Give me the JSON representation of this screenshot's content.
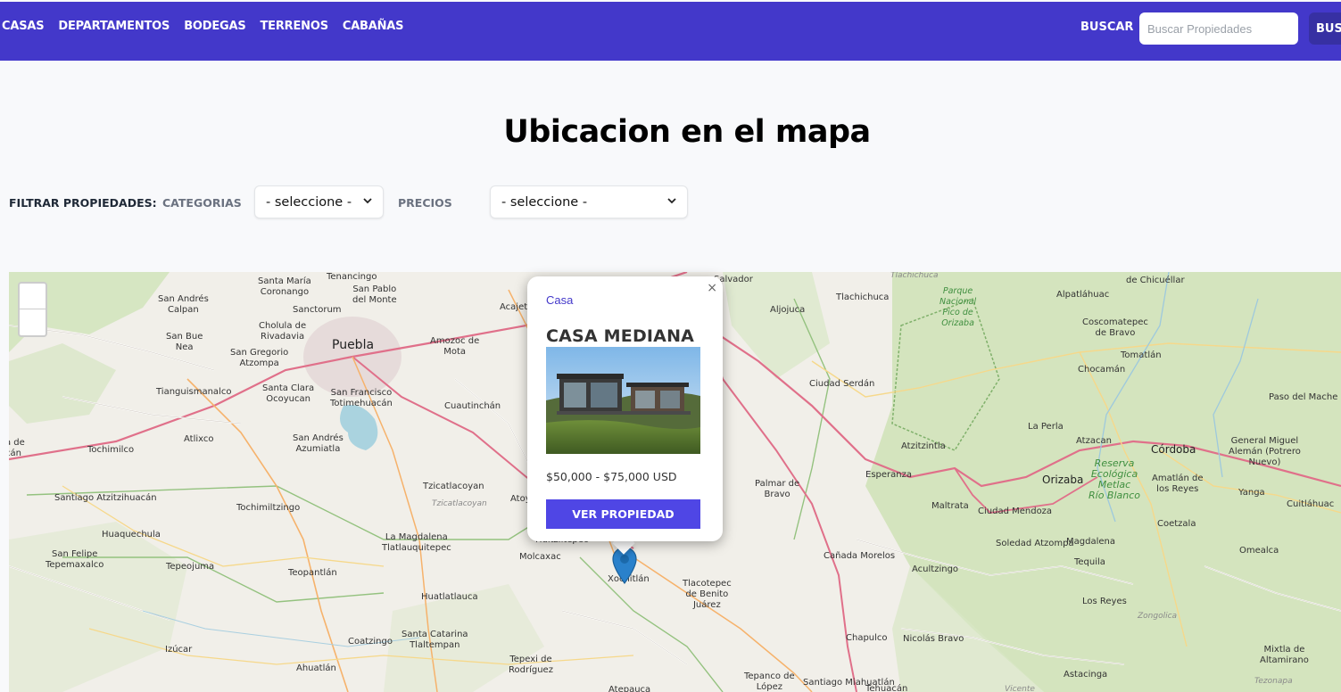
{
  "nav": {
    "items": [
      "CASAS",
      "DEPARTAMENTOS",
      "BODEGAS",
      "TERRENOS",
      "CABAÑAS"
    ],
    "search_label": "BUSCAR",
    "search_placeholder": "Buscar Propiedades",
    "search_button": "BUSCAR"
  },
  "page": {
    "title": "Ubicacion en el mapa"
  },
  "filters": {
    "title": "FILTRAR PROPIEDADES:",
    "category_label": "CATEGORIAS",
    "category_value": "- seleccione -",
    "price_label": "PRECIOS",
    "price_value": "- seleccione -"
  },
  "popup": {
    "category": "Casa",
    "title": "CASA MEDIANA",
    "price": "$50,000 - $75,000 USD",
    "button": "VER PROPIEDAD",
    "close": "×"
  },
  "map": {
    "zoom_in": "+",
    "zoom_out": "−",
    "places": [
      {
        "t": "Santa María\nCoronango",
        "c": ""
      },
      {
        "t": "Tenancingo",
        "c": ""
      },
      {
        "t": "San Pablo\ndel Monte",
        "c": ""
      },
      {
        "t": "San Andrés\nCalpan",
        "c": ""
      },
      {
        "t": "Sanctorum",
        "c": ""
      },
      {
        "t": "Cholula de\nRivadavia",
        "c": ""
      },
      {
        "t": "Puebla",
        "c": "big"
      },
      {
        "t": "Amozoc de\nMota",
        "c": ""
      },
      {
        "t": "San Bue\nNea",
        "c": ""
      },
      {
        "t": "San Gregorio\nAtzompa",
        "c": ""
      },
      {
        "t": "Tianguismanalco",
        "c": ""
      },
      {
        "t": "Santa Clara\nOcoyucan",
        "c": ""
      },
      {
        "t": "San Francisco\nTotimehuacán",
        "c": ""
      },
      {
        "t": "Cuautinchán",
        "c": ""
      },
      {
        "t": "Acajete",
        "c": ""
      },
      {
        "t": "Atlixco",
        "c": ""
      },
      {
        "t": "Tochimilco",
        "c": ""
      },
      {
        "t": "San Andrés\nAzumiatla",
        "c": ""
      },
      {
        "t": "Tzicatlacoyan",
        "c": ""
      },
      {
        "t": "Tzicatlacoyan",
        "c": "gray"
      },
      {
        "t": "Atoy",
        "c": ""
      },
      {
        "t": "Santiago Atzitzihuacán",
        "c": ""
      },
      {
        "t": "Tochimiltzingo",
        "c": ""
      },
      {
        "t": "Huaquechula",
        "c": ""
      },
      {
        "t": "La Magdalena\nTlatlauquitepec",
        "c": ""
      },
      {
        "t": "Huitziltepec",
        "c": ""
      },
      {
        "t": "Molcaxac",
        "c": ""
      },
      {
        "t": "San Felipe\nTepemaxalco",
        "c": ""
      },
      {
        "t": "Tepeojuma",
        "c": ""
      },
      {
        "t": "Teopantlán",
        "c": ""
      },
      {
        "t": "Huatlatlauca",
        "c": ""
      },
      {
        "t": "Xochitlán",
        "c": ""
      },
      {
        "t": "Tlacotepec\nde Benito\nJuárez",
        "c": ""
      },
      {
        "t": "Izúcar",
        "c": ""
      },
      {
        "t": "Coatzingo",
        "c": ""
      },
      {
        "t": "Santa Catarina\nTlaltempan",
        "c": ""
      },
      {
        "t": "Ahuatlán",
        "c": ""
      },
      {
        "t": "Tepexi de\nRodríguez",
        "c": ""
      },
      {
        "t": "Atepauca",
        "c": ""
      },
      {
        "t": "Tepanco de\nLópez",
        "c": ""
      },
      {
        "t": "Santiago Miahuatlán",
        "c": ""
      },
      {
        "t": "Tehuacán",
        "c": ""
      },
      {
        "t": "Chapulco",
        "c": ""
      },
      {
        "t": "Nicolás Bravo",
        "c": ""
      },
      {
        "t": "Cañada Morelos",
        "c": ""
      },
      {
        "t": "Palmar de\nBravo",
        "c": ""
      },
      {
        "t": "Esperanza",
        "c": ""
      },
      {
        "t": "Atzitzintla",
        "c": ""
      },
      {
        "t": "Ciudad Serdán",
        "c": ""
      },
      {
        "t": "Aljojuca",
        "c": ""
      },
      {
        "t": "Tlachichuca",
        "c": ""
      },
      {
        "t": "Tlachichuca",
        "c": "gray"
      },
      {
        "t": "Salvador",
        "c": ""
      },
      {
        "t": "Parque\nNacional\nPico de\nOrizaba",
        "c": "greensm"
      },
      {
        "t": "Alpatláhuac",
        "c": ""
      },
      {
        "t": "de Chicuéllar",
        "c": ""
      },
      {
        "t": "Coscomatepec\nde Bravo",
        "c": ""
      },
      {
        "t": "Tomatlán",
        "c": ""
      },
      {
        "t": "Chocamán",
        "c": ""
      },
      {
        "t": "Paso del Mache",
        "c": ""
      },
      {
        "t": "La Perla",
        "c": ""
      },
      {
        "t": "Atzacan",
        "c": ""
      },
      {
        "t": "Córdoba",
        "c": "mid"
      },
      {
        "t": "Orizaba",
        "c": "mid"
      },
      {
        "t": "Reserva\nEcológica\nMetlac\nRío Blanco",
        "c": "green"
      },
      {
        "t": "Amatlán de\nlos Reyes",
        "c": ""
      },
      {
        "t": "General Miguel\nAlemán (Potrero\nNuevo)",
        "c": ""
      },
      {
        "t": "Yanga",
        "c": ""
      },
      {
        "t": "Cuitláhuac",
        "c": ""
      },
      {
        "t": "Maltrata",
        "c": ""
      },
      {
        "t": "Ciudad Mendoza",
        "c": ""
      },
      {
        "t": "Soledad Atzompa",
        "c": ""
      },
      {
        "t": "Magdalena",
        "c": ""
      },
      {
        "t": "Coetzala",
        "c": ""
      },
      {
        "t": "Omealca",
        "c": ""
      },
      {
        "t": "Acultzingo",
        "c": ""
      },
      {
        "t": "Tequila",
        "c": ""
      },
      {
        "t": "Los Reyes",
        "c": ""
      },
      {
        "t": "Zongolica",
        "c": "gray"
      },
      {
        "t": "Mixtla de\nAltamirano",
        "c": ""
      },
      {
        "t": "Astacinga",
        "c": ""
      },
      {
        "t": "Tezonapa",
        "c": "gray"
      },
      {
        "t": "Vicente",
        "c": "gray"
      },
      {
        "t": "a de\ncán",
        "c": ""
      }
    ]
  }
}
